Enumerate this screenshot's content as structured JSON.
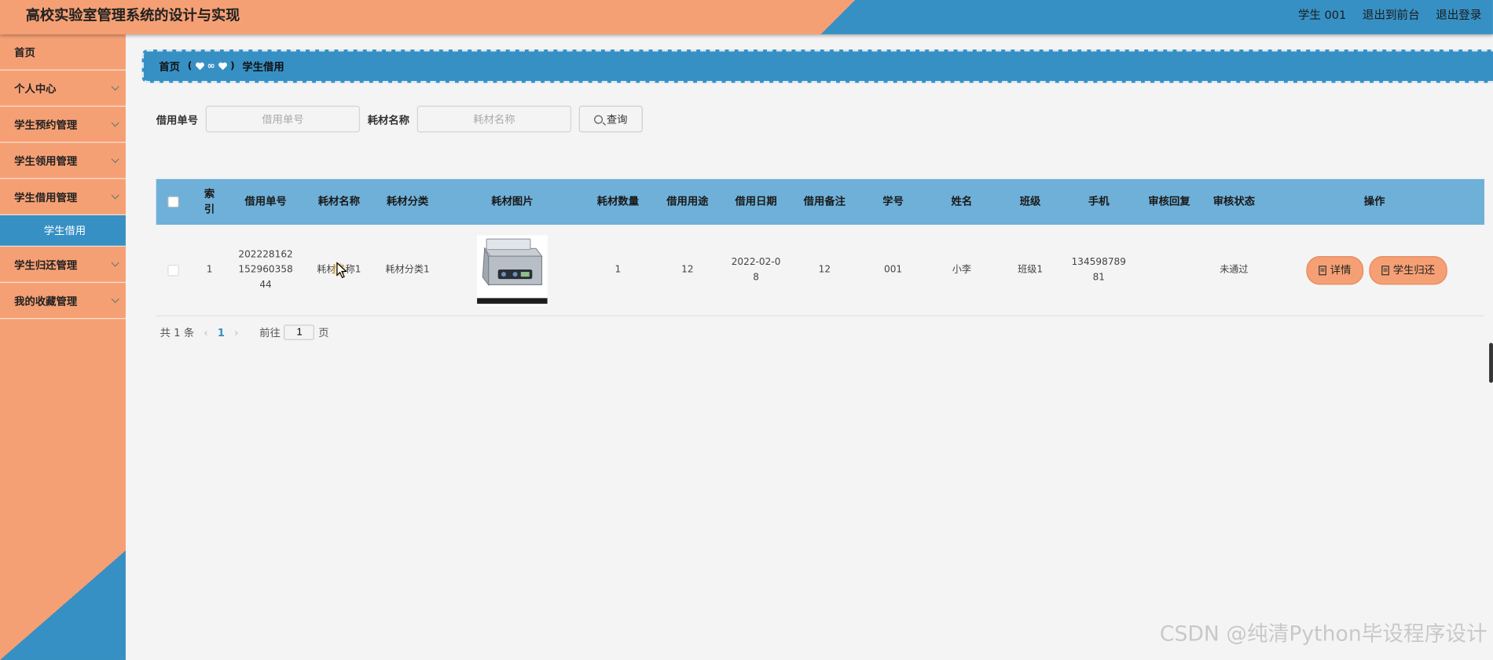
{
  "header": {
    "title": "高校实验室管理系统的设计与实现",
    "user": "学生 001",
    "to_front": "退出到前台",
    "logout": "退出登录"
  },
  "sidebar": {
    "items": [
      {
        "label": "首页"
      },
      {
        "label": "个人中心"
      },
      {
        "label": "学生预约管理"
      },
      {
        "label": "学生领用管理"
      },
      {
        "label": "学生借用管理"
      },
      {
        "label": "学生借用"
      },
      {
        "label": "学生归还管理"
      },
      {
        "label": "我的收藏管理"
      }
    ]
  },
  "breadcrumb": {
    "home": "首页",
    "current": "学生借用"
  },
  "search": {
    "field1_label": "借用单号",
    "field1_placeholder": "借用单号",
    "field2_label": "耗材名称",
    "field2_placeholder": "耗材名称",
    "button": "查询"
  },
  "table": {
    "headers": [
      "索引",
      "借用单号",
      "耗材名称",
      "耗材分类",
      "耗材图片",
      "耗材数量",
      "借用用途",
      "借用日期",
      "借用备注",
      "学号",
      "姓名",
      "班级",
      "手机",
      "审核回复",
      "审核状态",
      "操作"
    ],
    "rows": [
      {
        "index": "1",
        "order_no": "20222816215296035844",
        "name": "耗材名称1",
        "category": "耗材分类1",
        "image": "ultrasonic-cleaner-image",
        "quantity": "1",
        "purpose": "12",
        "date": "2022-02-08",
        "remark": "12",
        "student_no": "001",
        "student_name": "小李",
        "class": "班级1",
        "phone": "13459878981",
        "reply": "",
        "status": "未通过",
        "actions": [
          "详情",
          "学生归还"
        ]
      }
    ]
  },
  "pagination": {
    "total": "共 1 条",
    "current_page": "1",
    "goto": "前往",
    "goto_value": "1",
    "page_unit": "页"
  },
  "watermark": "CSDN @纯清Python毕设程序设计",
  "colors": {
    "orange": "#f5a074",
    "blue": "#3790c4",
    "table_head": "#6fb0d8"
  }
}
